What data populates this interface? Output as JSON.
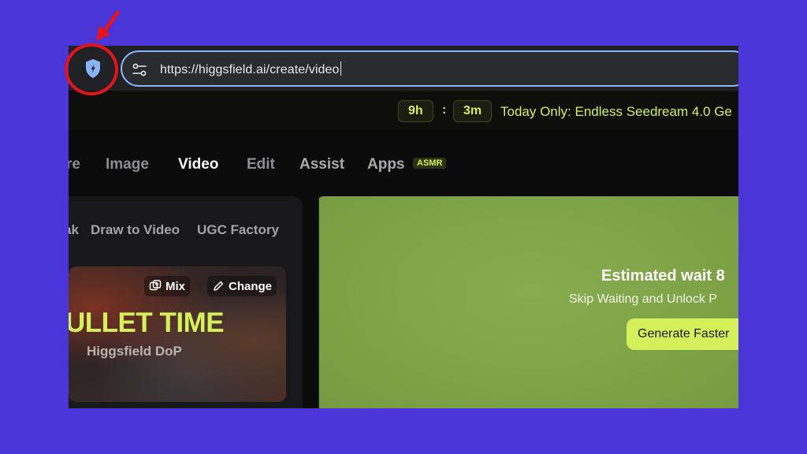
{
  "browser": {
    "url": "https://higgsfield.ai/create/video",
    "shield_icon": "shield-icon",
    "site_settings_icon": "tune-icon"
  },
  "promo": {
    "hours": "9h",
    "separator": ":",
    "minutes": "3m",
    "text": "Today Only: Endless Seedream 4.0 Ge"
  },
  "nav": {
    "items": [
      {
        "label": "re"
      },
      {
        "label": "Image"
      },
      {
        "label": "Video"
      },
      {
        "label": "Edit"
      },
      {
        "label": "Assist"
      },
      {
        "label": "Apps"
      }
    ],
    "badge": "ASMR"
  },
  "sub_tabs": [
    {
      "label": "ak"
    },
    {
      "label": "Draw to Video"
    },
    {
      "label": "UGC Factory"
    }
  ],
  "card": {
    "mix_label": "Mix",
    "change_label": "Change",
    "title": "ULLET TIME",
    "subtitle": "Higgsfield DoP"
  },
  "preview": {
    "wait_title": "Estimated wait 8",
    "wait_sub": "Skip Waiting and Unlock P",
    "button": "Generate Faster"
  },
  "colors": {
    "background": "#4a35d8",
    "accent": "#d5f05a",
    "annotation": "#e3141b",
    "url_focus": "#8ab4f8"
  }
}
